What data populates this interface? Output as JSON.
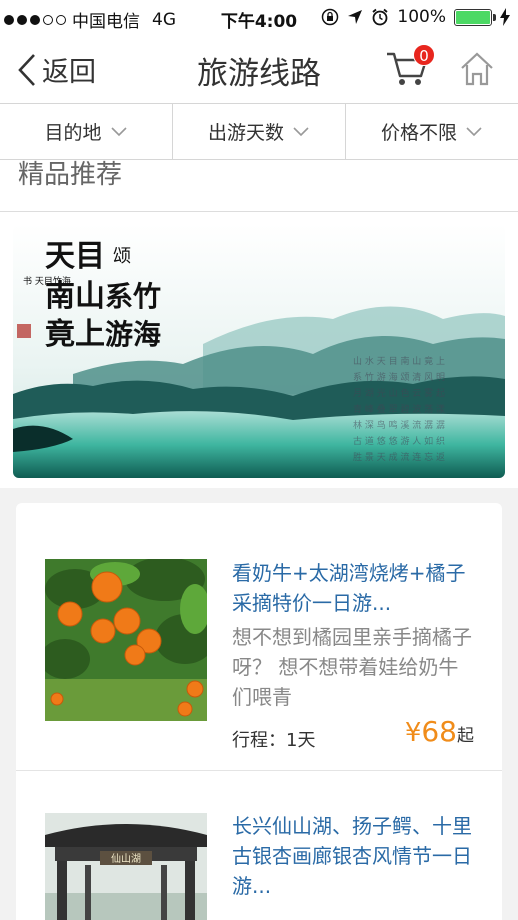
{
  "status_bar": {
    "carrier": "中国电信",
    "network": "4G",
    "time": "下午4:00",
    "battery": "100%"
  },
  "nav": {
    "back_label": "返回",
    "title": "旅游线路",
    "cart_count": "0"
  },
  "filters": [
    {
      "label": "目的地"
    },
    {
      "label": "出游天数"
    },
    {
      "label": "价格不限"
    }
  ],
  "section": {
    "title": "精品推荐"
  },
  "banner": {
    "calligraphy_lines": [
      "天目",
      "南山",
      "竟上",
      "系竹",
      "游海",
      "颂"
    ]
  },
  "routes": [
    {
      "title": "看奶牛+太湖湾烧烤+橘子采摘特价一日游...",
      "description": "想不想到橘园里亲手摘橘子呀？ 想不想带着娃给奶牛们喂青",
      "duration": "行程：1天",
      "price_currency": "¥",
      "price": "68",
      "price_suffix": "起"
    },
    {
      "title": "长兴仙山湖、扬子鳄、十里古银杏画廊银杏风情节一日游...",
      "gate_sign": "仙山湖"
    }
  ],
  "colors": {
    "link": "#2a6aa6",
    "price": "#f08c1a",
    "badge": "#e8261e",
    "battery": "#4cd964"
  }
}
